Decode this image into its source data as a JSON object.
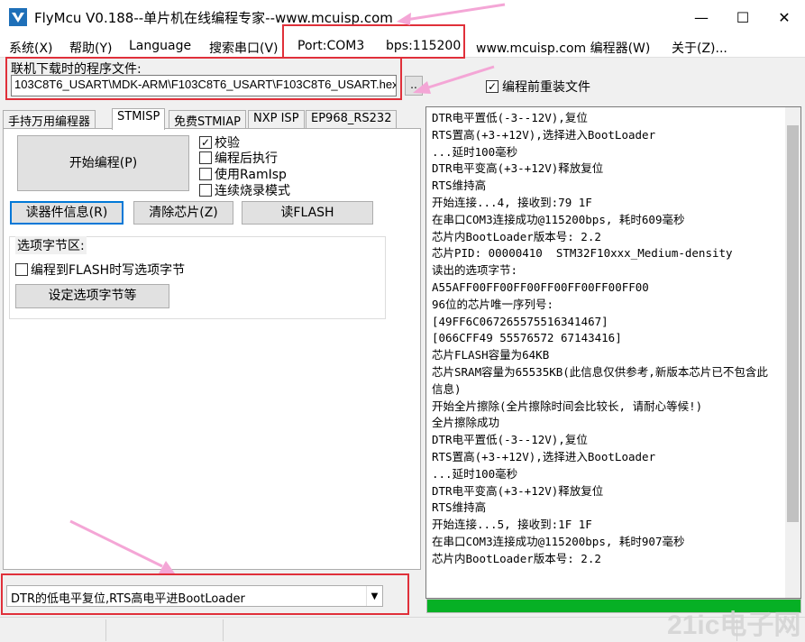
{
  "window": {
    "title": "FlyMcu V0.188--单片机在线编程专家--www.mcuisp.com",
    "minimize_glyph": "—",
    "maximize_glyph": "☐",
    "close_glyph": "✕"
  },
  "menu": {
    "items": [
      "系统(X)",
      "帮助(Y)",
      "Language",
      "搜索串口(V)",
      "Port:COM3",
      "bps:115200",
      "www.mcuisp.com 编程器(W)",
      "关于(Z)..."
    ]
  },
  "file": {
    "label": "联机下载时的程序文件:",
    "path": "103C8T6_USART\\MDK-ARM\\F103C8T6_USART\\F103C8T6_USART.hex",
    "browse_label": "..",
    "reload_label": "编程前重装文件",
    "reload_checked": true
  },
  "tabs": [
    "手持万用编程器",
    "STMISP",
    "免费STMIAP",
    "NXP ISP",
    "EP968_RS232"
  ],
  "stmisp": {
    "start_button": "开始编程(P)",
    "verify_label": "校验",
    "verify_checked": true,
    "run_after_label": "编程后执行",
    "run_after_checked": false,
    "use_ramisp_label": "使用RamIsp",
    "use_ramisp_checked": false,
    "continuous_label": "连续烧录模式",
    "continuous_checked": false,
    "read_info_button": "读器件信息(R)",
    "clear_chip_button": "清除芯片(Z)",
    "read_flash_button": "读FLASH",
    "option_group_label": "选项字节区:",
    "write_option_label": "编程到FLASH时写选项字节",
    "write_option_checked": false,
    "set_option_button": "设定选项字节等"
  },
  "log": {
    "lines": [
      "DTR电平置低(-3--12V),复位",
      "RTS置高(+3-+12V),选择进入BootLoader",
      "...延时100毫秒",
      "DTR电平变高(+3-+12V)释放复位",
      "RTS维持高",
      "开始连接...4, 接收到:79 1F",
      "在串口COM3连接成功@115200bps, 耗时609毫秒",
      "芯片内BootLoader版本号: 2.2",
      "芯片PID: 00000410  STM32F10xxx_Medium-density",
      "读出的选项字节:",
      "A55AFF00FF00FF00FF00FF00FF00FF00",
      "96位的芯片唯一序列号:",
      "[49FF6C067265575516341467]",
      "[066CFF49 55576572 67143416]",
      "芯片FLASH容量为64KB",
      "芯片SRAM容量为65535KB(此信息仅供参考,新版本芯片已不包含此信息)",
      "开始全片擦除(全片擦除时间会比较长, 请耐心等候!)",
      "全片擦除成功",
      "DTR电平置低(-3--12V),复位",
      "RTS置高(+3-+12V),选择进入BootLoader",
      "...延时100毫秒",
      "DTR电平变高(+3-+12V)释放复位",
      "RTS维持高",
      "开始连接...5, 接收到:1F 1F",
      "在串口COM3连接成功@115200bps, 耗时907毫秒",
      "芯片内BootLoader版本号: 2.2"
    ]
  },
  "progress": 1.0,
  "reset_mode": {
    "selected": "DTR的低电平复位,RTS高电平进BootLoader"
  },
  "watermark": "21ic电子网",
  "colors": {
    "annotation": "#e0303a",
    "arrow": "#f4a6d6",
    "progress": "#06b025"
  }
}
